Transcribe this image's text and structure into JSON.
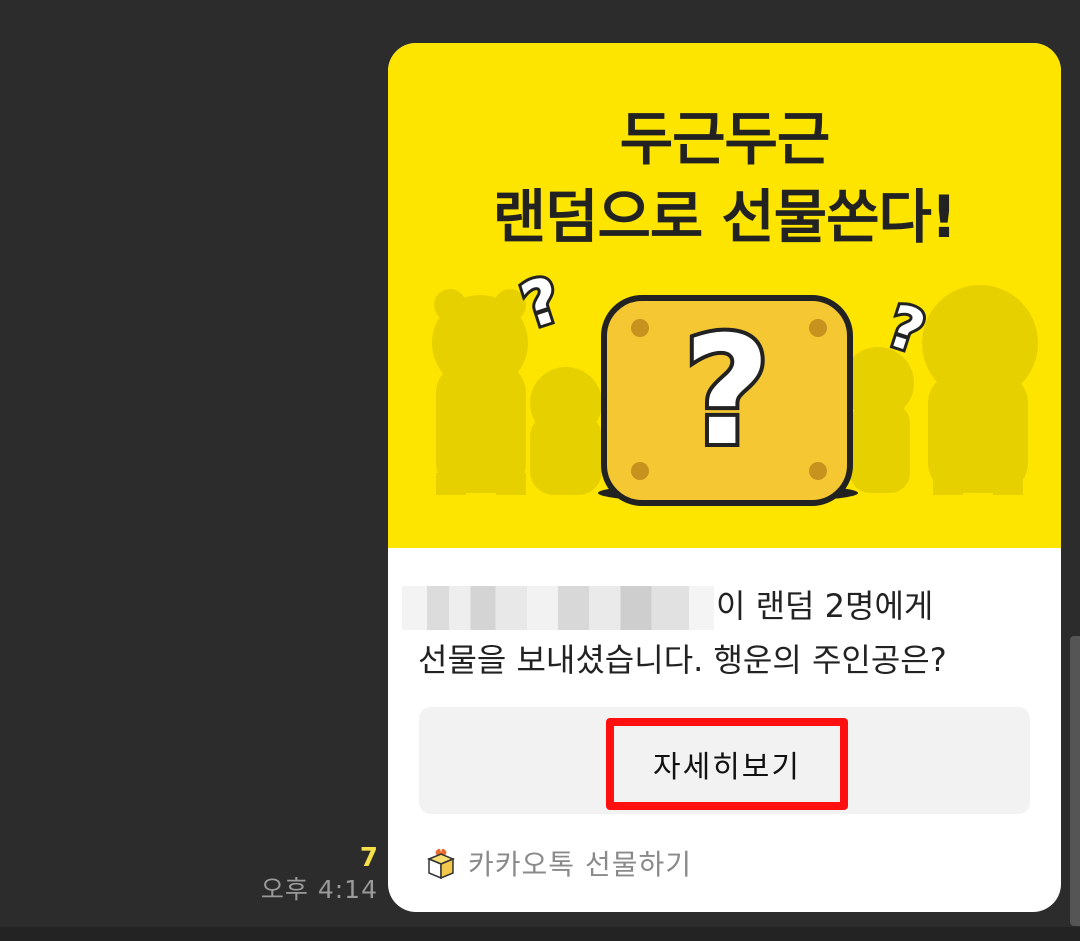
{
  "chat": {
    "unread_count": "7",
    "timestamp": "오후 4:14"
  },
  "card": {
    "banner": {
      "headline_line1": "두근두근",
      "headline_line2": "랜덤으로 선물쏜다!",
      "colors": {
        "background": "#fde500",
        "box": "#f5c833",
        "outline": "#222222"
      }
    },
    "message": {
      "line1_suffix": "이 랜덤 2명에게",
      "line2": "선물을 보내셨습니다. 행운의 주인공은?"
    },
    "detail_button_label": "자세히보기",
    "highlight_color": "#ff1010",
    "footer_label": "카카오톡 선물하기",
    "footer_icon": "gift-box-icon"
  }
}
